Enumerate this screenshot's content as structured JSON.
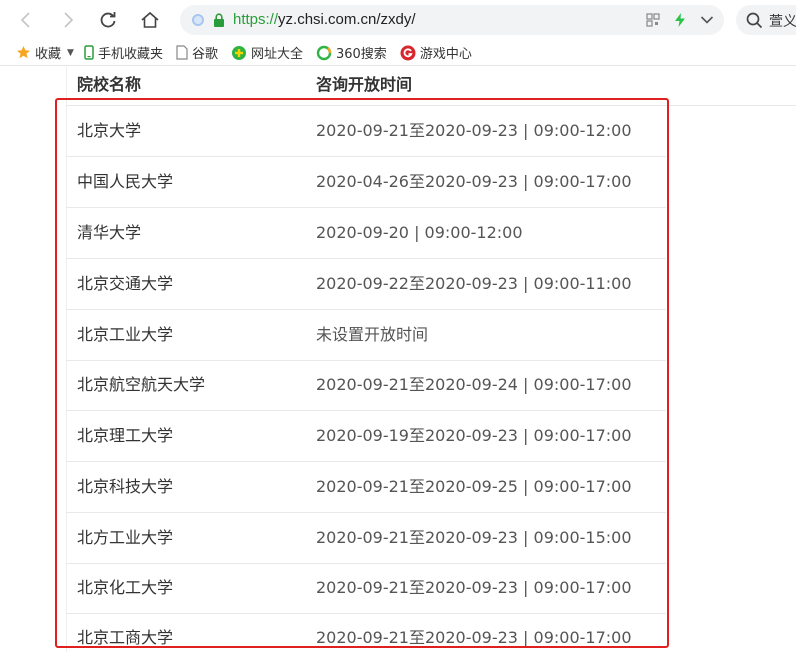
{
  "browser": {
    "url": {
      "scheme": "https://",
      "rest": "yz.chsi.com.cn/zxdy/"
    },
    "search_text": "萱义"
  },
  "bookmarks": [
    {
      "label": "收藏",
      "icon": "star-icon"
    },
    {
      "label": "手机收藏夹",
      "icon": "phone-icon"
    },
    {
      "label": "谷歌",
      "icon": "page-icon"
    },
    {
      "label": "网址大全",
      "icon": "globe-plus-icon"
    },
    {
      "label": "360搜索",
      "icon": "search-360-icon"
    },
    {
      "label": "游戏中心",
      "icon": "game-icon"
    }
  ],
  "table": {
    "headers": [
      "院校名称",
      "咨询开放时间"
    ],
    "rows": [
      {
        "name": "北京大学",
        "time": "2020-09-21至2020-09-23 | 09:00-12:00"
      },
      {
        "name": "中国人民大学",
        "time": "2020-04-26至2020-09-23 | 09:00-17:00"
      },
      {
        "name": "清华大学",
        "time": "2020-09-20 | 09:00-12:00"
      },
      {
        "name": "北京交通大学",
        "time": "2020-09-22至2020-09-23 | 09:00-11:00"
      },
      {
        "name": "北京工业大学",
        "time": "未设置开放时间"
      },
      {
        "name": "北京航空航天大学",
        "time": "2020-09-21至2020-09-24 | 09:00-17:00"
      },
      {
        "name": "北京理工大学",
        "time": "2020-09-19至2020-09-23 | 09:00-17:00"
      },
      {
        "name": "北京科技大学",
        "time": "2020-09-21至2020-09-25 | 09:00-17:00"
      },
      {
        "name": "北方工业大学",
        "time": "2020-09-21至2020-09-23 | 09:00-15:00"
      },
      {
        "name": "北京化工大学",
        "time": "2020-09-21至2020-09-23 | 09:00-17:00"
      },
      {
        "name": "北京工商大学",
        "time": "2020-09-21至2020-09-23 | 09:00-17:00"
      }
    ]
  },
  "colors": {
    "highlight_border": "#e02020",
    "url_scheme": "#2a9d3a"
  }
}
